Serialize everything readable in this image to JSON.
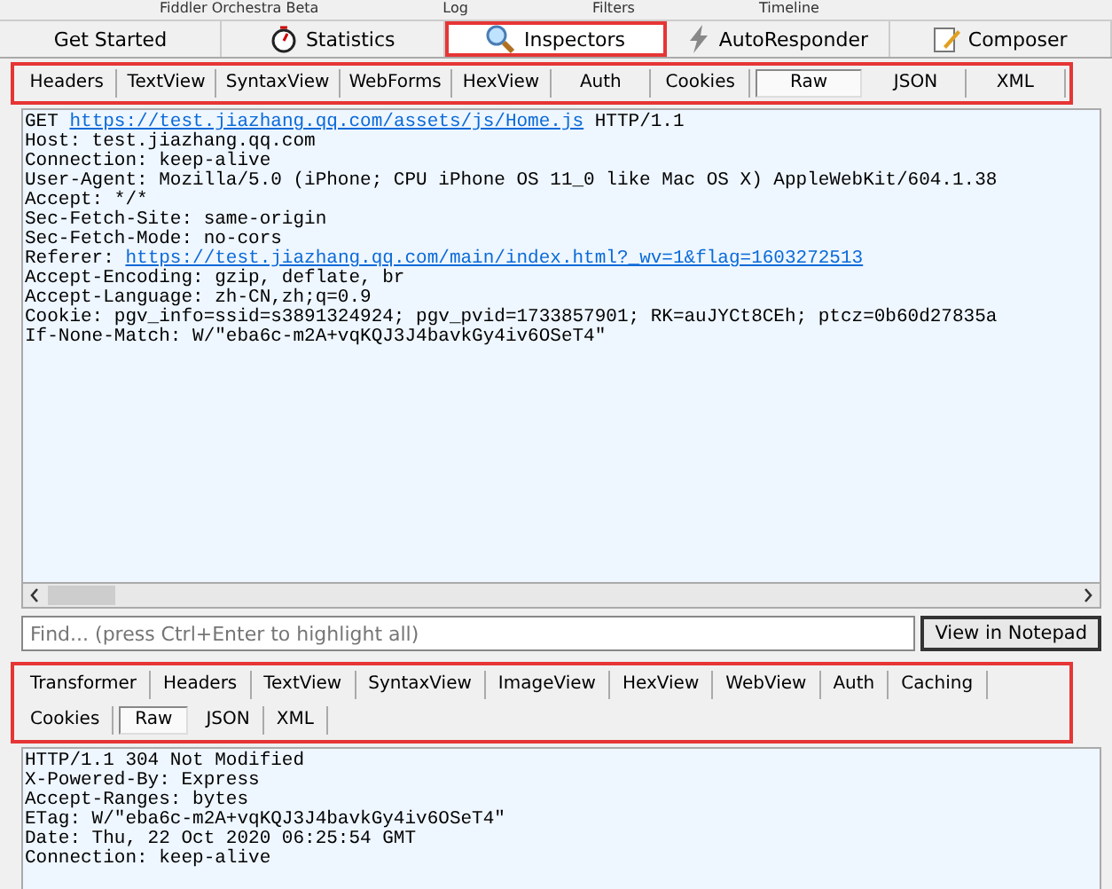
{
  "top_tabs": [
    "Fiddler Orchestra Beta",
    "Log",
    "Filters",
    "Timeline"
  ],
  "main_tabs": [
    {
      "label": "Get Started",
      "selected": false
    },
    {
      "label": "Statistics",
      "selected": false
    },
    {
      "label": "Inspectors",
      "selected": true
    },
    {
      "label": "AutoResponder",
      "selected": false
    },
    {
      "label": "Composer",
      "selected": false
    }
  ],
  "request": {
    "tabs": [
      {
        "label": "Headers",
        "selected": false
      },
      {
        "label": "TextView",
        "selected": false
      },
      {
        "label": "SyntaxView",
        "selected": false
      },
      {
        "label": "WebForms",
        "selected": false
      },
      {
        "label": "HexView",
        "selected": false
      },
      {
        "label": "Auth",
        "selected": false
      },
      {
        "label": "Cookies",
        "selected": false
      },
      {
        "label": "Raw",
        "selected": true
      },
      {
        "label": "JSON",
        "selected": false
      },
      {
        "label": "XML",
        "selected": false
      }
    ],
    "lines": [
      [
        {
          "text": "GET ",
          "link": false
        },
        {
          "text": "https://test.jiazhang.qq.com/assets/js/Home.js",
          "link": true
        },
        {
          "text": " HTTP/1.1",
          "link": false
        }
      ],
      [
        {
          "text": "Host: test.jiazhang.qq.com",
          "link": false
        }
      ],
      [
        {
          "text": "Connection: keep-alive",
          "link": false
        }
      ],
      [
        {
          "text": "User-Agent: Mozilla/5.0 (iPhone; CPU iPhone OS 11_0 like Mac OS X) AppleWebKit/604.1.38",
          "link": false
        }
      ],
      [
        {
          "text": "Accept: */*",
          "link": false
        }
      ],
      [
        {
          "text": "Sec-Fetch-Site: same-origin",
          "link": false
        }
      ],
      [
        {
          "text": "Sec-Fetch-Mode: no-cors",
          "link": false
        }
      ],
      [
        {
          "text": "Referer: ",
          "link": false
        },
        {
          "text": "https://test.jiazhang.qq.com/main/index.html?_wv=1&flag=1603272513",
          "link": true
        }
      ],
      [
        {
          "text": "Accept-Encoding: gzip, deflate, br",
          "link": false
        }
      ],
      [
        {
          "text": "Accept-Language: zh-CN,zh;q=0.9",
          "link": false
        }
      ],
      [
        {
          "text": "Cookie: pgv_info=ssid=s3891324924; pgv_pvid=1733857901; RK=auJYCt8CEh; ptcz=0b60d27835a",
          "link": false
        }
      ],
      [
        {
          "text": "If-None-Match: W/\"eba6c-m2A+vqKQJ3J4bavkGy4iv6OSeT4\"",
          "link": false
        }
      ]
    ],
    "find": {
      "placeholder": "Find... (press Ctrl+Enter to highlight all)"
    },
    "notepad_button": "View in Notepad"
  },
  "response": {
    "tabs": [
      {
        "label": "Transformer",
        "selected": false
      },
      {
        "label": "Headers",
        "selected": false
      },
      {
        "label": "TextView",
        "selected": false
      },
      {
        "label": "SyntaxView",
        "selected": false
      },
      {
        "label": "ImageView",
        "selected": false
      },
      {
        "label": "HexView",
        "selected": false
      },
      {
        "label": "WebView",
        "selected": false
      },
      {
        "label": "Auth",
        "selected": false
      },
      {
        "label": "Caching",
        "selected": false
      },
      {
        "label": "Cookies",
        "selected": false
      },
      {
        "label": "Raw",
        "selected": true
      },
      {
        "label": "JSON",
        "selected": false
      },
      {
        "label": "XML",
        "selected": false
      }
    ],
    "lines": [
      "HTTP/1.1 304 Not Modified",
      "X-Powered-By: Express",
      "Accept-Ranges: bytes",
      "ETag: W/\"eba6c-m2A+vqKQJ3J4bavkGy4iv6OSeT4\"",
      "Date: Thu, 22 Oct 2020 06:25:54 GMT",
      "Connection: keep-alive"
    ]
  }
}
